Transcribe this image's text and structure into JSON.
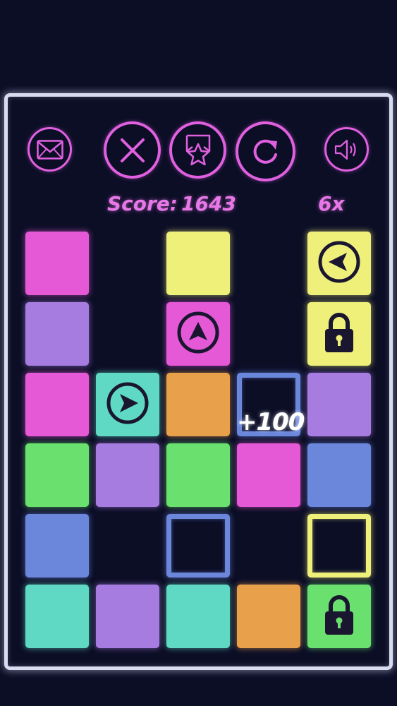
{
  "toolbar": {
    "mail_icon": "envelope-icon",
    "close_icon": "x-icon",
    "rate_icon": "star-badge-icon",
    "restart_icon": "restart-icon",
    "sound_icon": "speaker-icon",
    "accent_color": "#e060e0"
  },
  "hud": {
    "score_label": "Score:",
    "score_value": "1643",
    "multiplier": "6x"
  },
  "popup": {
    "text": "+100"
  },
  "palette": {
    "pink": "#e559d6",
    "purple": "#a77ce0",
    "yellow": "#eef07a",
    "teal": "#5fd9c3",
    "orange": "#e8a04a",
    "green": "#6ae06e",
    "blue": "#6b87dc",
    "frame": "#d9dcef",
    "background": "#0c0e26"
  },
  "board": {
    "columns": 5,
    "rows": 6,
    "tiles": [
      {
        "row": 0,
        "col": 0,
        "color": "pink",
        "style": "solid",
        "icon": ""
      },
      {
        "row": 0,
        "col": 2,
        "color": "yellow",
        "style": "solid",
        "icon": ""
      },
      {
        "row": 0,
        "col": 4,
        "color": "yellow",
        "style": "solid",
        "icon": "arrow-left-icon"
      },
      {
        "row": 1,
        "col": 0,
        "color": "purple",
        "style": "solid",
        "icon": ""
      },
      {
        "row": 1,
        "col": 2,
        "color": "pink",
        "style": "solid",
        "icon": "arrow-up-icon"
      },
      {
        "row": 1,
        "col": 4,
        "color": "yellow",
        "style": "solid",
        "icon": "lock-icon"
      },
      {
        "row": 2,
        "col": 0,
        "color": "pink",
        "style": "solid",
        "icon": ""
      },
      {
        "row": 2,
        "col": 1,
        "color": "teal",
        "style": "solid",
        "icon": "arrow-right-icon"
      },
      {
        "row": 2,
        "col": 2,
        "color": "orange",
        "style": "solid",
        "icon": ""
      },
      {
        "row": 2,
        "col": 3,
        "color": "blue",
        "style": "outline",
        "icon": ""
      },
      {
        "row": 2,
        "col": 4,
        "color": "purple",
        "style": "solid",
        "icon": ""
      },
      {
        "row": 3,
        "col": 0,
        "color": "green",
        "style": "solid",
        "icon": ""
      },
      {
        "row": 3,
        "col": 1,
        "color": "purple",
        "style": "solid",
        "icon": ""
      },
      {
        "row": 3,
        "col": 2,
        "color": "green",
        "style": "solid",
        "icon": ""
      },
      {
        "row": 3,
        "col": 3,
        "color": "pink",
        "style": "solid",
        "icon": ""
      },
      {
        "row": 3,
        "col": 4,
        "color": "blue",
        "style": "solid",
        "icon": ""
      },
      {
        "row": 4,
        "col": 0,
        "color": "blue",
        "style": "solid",
        "icon": ""
      },
      {
        "row": 4,
        "col": 2,
        "color": "blue",
        "style": "outline",
        "icon": ""
      },
      {
        "row": 4,
        "col": 4,
        "color": "yellow",
        "style": "outline",
        "icon": ""
      },
      {
        "row": 5,
        "col": 0,
        "color": "teal",
        "style": "solid",
        "icon": ""
      },
      {
        "row": 5,
        "col": 1,
        "color": "purple",
        "style": "solid",
        "icon": ""
      },
      {
        "row": 5,
        "col": 2,
        "color": "teal",
        "style": "solid",
        "icon": ""
      },
      {
        "row": 5,
        "col": 3,
        "color": "orange",
        "style": "solid",
        "icon": ""
      },
      {
        "row": 5,
        "col": 4,
        "color": "green",
        "style": "solid",
        "icon": "lock-icon"
      }
    ]
  }
}
